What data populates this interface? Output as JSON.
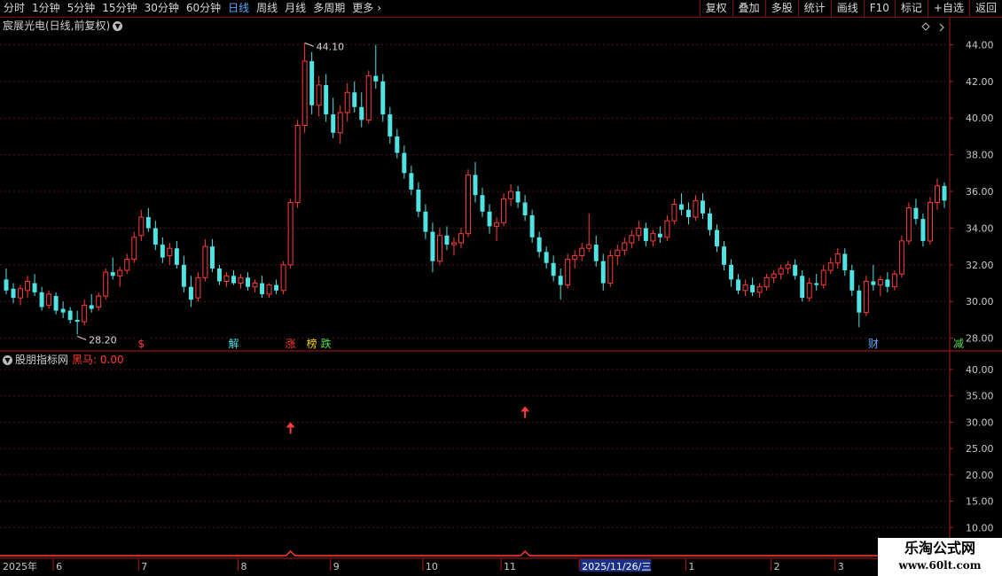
{
  "toolbar": {
    "periods": [
      "分时",
      "1分钟",
      "5分钟",
      "15分钟",
      "30分钟",
      "60分钟",
      "日线",
      "周线",
      "月线",
      "多周期",
      "更多"
    ],
    "active_period": "日线",
    "more_arrow": "chevron-right-icon",
    "buttons": [
      "复权",
      "叠加",
      "多股",
      "统计",
      "画线",
      "F10",
      "标记",
      "+自选",
      "返回"
    ]
  },
  "main": {
    "title": "宸展光电(日线,前复权)",
    "title_icon": "chevron-down-icon",
    "corner_icon": "diamond-icon"
  },
  "indicator": {
    "name": "股朋指标网",
    "series_label": "黑马: 0.00"
  },
  "watermark": {
    "line1": "乐淘公式网",
    "line2": "www.60lt.com"
  },
  "colors": {
    "up": "#ff3b3b",
    "down": "#4fe3e3",
    "grid": "#5a1414",
    "border": "#b01818",
    "axis_text": "#c8c8c8",
    "active": "#5aa8ff"
  },
  "chart_data": [
    {
      "type": "candlestick",
      "title": "宸展光电(日线,前复权)",
      "ylim": [
        27.5,
        44.6
      ],
      "yticks": [
        "44.00",
        "42.00",
        "40.00",
        "38.00",
        "36.00",
        "34.00",
        "32.00",
        "30.00",
        "28.00"
      ],
      "annotations": [
        {
          "text": "44.10",
          "value": 44.1,
          "index": 42
        },
        {
          "text": "28.20",
          "value": 28.2,
          "index": 10
        }
      ],
      "event_markers": [
        {
          "text": "$",
          "index": 19,
          "color": "#ff3b3b"
        },
        {
          "text": "解",
          "index": 32,
          "color": "#4fe3e3"
        },
        {
          "text": "涨",
          "index": 40,
          "color": "#ff3b3b"
        },
        {
          "text": "榜",
          "index": 43,
          "color": "#ffd400"
        },
        {
          "text": "跌",
          "index": 45,
          "color": "#55dd55"
        },
        {
          "text": "财",
          "index": 122,
          "color": "#5aa8ff"
        },
        {
          "text": "减",
          "index": 134,
          "color": "#55dd55"
        }
      ],
      "x_labels": [
        {
          "text": "2025年",
          "index": 0
        },
        {
          "text": "6",
          "index": 7
        },
        {
          "text": "7",
          "index": 19
        },
        {
          "text": "8",
          "index": 33
        },
        {
          "text": "9",
          "index": 46
        },
        {
          "text": "10",
          "index": 59
        },
        {
          "text": "11",
          "index": 70
        },
        {
          "text": "2025/11/26/三",
          "index": 81,
          "highlight": true
        },
        {
          "text": "1",
          "index": 96
        },
        {
          "text": "2",
          "index": 108
        },
        {
          "text": "3",
          "index": 117
        }
      ],
      "ohlc": [
        [
          31.2,
          31.8,
          30.4,
          30.6
        ],
        [
          30.7,
          31.0,
          29.9,
          30.2
        ],
        [
          30.2,
          30.9,
          29.8,
          30.7
        ],
        [
          30.6,
          31.4,
          30.2,
          31.1
        ],
        [
          31.0,
          31.5,
          30.3,
          30.5
        ],
        [
          30.5,
          30.8,
          29.5,
          29.7
        ],
        [
          29.8,
          30.6,
          29.6,
          30.4
        ],
        [
          30.3,
          30.5,
          29.3,
          29.5
        ],
        [
          29.6,
          30.0,
          29.1,
          29.4
        ],
        [
          29.5,
          29.7,
          28.8,
          29.0
        ],
        [
          29.0,
          29.5,
          28.2,
          28.9
        ],
        [
          28.9,
          30.1,
          28.7,
          29.8
        ],
        [
          29.8,
          30.4,
          29.4,
          29.6
        ],
        [
          29.7,
          30.5,
          29.5,
          30.3
        ],
        [
          30.3,
          31.8,
          30.1,
          31.6
        ],
        [
          31.6,
          32.4,
          31.2,
          31.4
        ],
        [
          31.4,
          31.9,
          30.8,
          31.7
        ],
        [
          31.7,
          32.6,
          31.5,
          32.3
        ],
        [
          32.3,
          33.8,
          32.1,
          33.5
        ],
        [
          33.6,
          35.0,
          33.3,
          34.6
        ],
        [
          34.6,
          35.1,
          33.8,
          34.0
        ],
        [
          34.0,
          34.4,
          32.8,
          33.1
        ],
        [
          33.1,
          33.5,
          32.1,
          32.4
        ],
        [
          32.5,
          33.2,
          32.0,
          32.9
        ],
        [
          32.9,
          33.3,
          31.8,
          32.0
        ],
        [
          32.0,
          32.5,
          30.5,
          30.8
        ],
        [
          30.8,
          31.4,
          29.7,
          30.1
        ],
        [
          30.2,
          31.6,
          30.0,
          31.3
        ],
        [
          31.3,
          33.4,
          31.1,
          33.0
        ],
        [
          33.0,
          33.4,
          31.6,
          31.8
        ],
        [
          31.8,
          32.0,
          30.9,
          31.1
        ],
        [
          31.1,
          31.6,
          30.8,
          31.4
        ],
        [
          31.4,
          31.7,
          30.9,
          31.0
        ],
        [
          31.0,
          31.5,
          30.7,
          31.3
        ],
        [
          31.3,
          31.6,
          30.6,
          30.8
        ],
        [
          30.8,
          31.2,
          30.5,
          31.0
        ],
        [
          31.0,
          31.4,
          30.2,
          30.4
        ],
        [
          30.4,
          31.0,
          30.2,
          30.9
        ],
        [
          30.9,
          31.2,
          30.4,
          30.6
        ],
        [
          30.6,
          32.2,
          30.4,
          32.0
        ],
        [
          32.0,
          35.6,
          31.8,
          35.4
        ],
        [
          35.4,
          39.9,
          35.1,
          39.6
        ],
        [
          39.6,
          44.1,
          39.2,
          43.1
        ],
        [
          43.1,
          43.6,
          40.2,
          40.7
        ],
        [
          40.7,
          42.3,
          40.1,
          41.8
        ],
        [
          41.8,
          42.4,
          39.8,
          40.2
        ],
        [
          40.2,
          41.1,
          38.9,
          39.2
        ],
        [
          39.2,
          40.7,
          38.6,
          40.3
        ],
        [
          40.3,
          41.9,
          39.8,
          41.4
        ],
        [
          41.4,
          42.0,
          40.3,
          40.6
        ],
        [
          40.6,
          41.4,
          39.5,
          39.9
        ],
        [
          39.9,
          42.6,
          39.7,
          42.3
        ],
        [
          42.3,
          44.0,
          41.6,
          42.0
        ],
        [
          42.0,
          42.4,
          39.8,
          40.2
        ],
        [
          40.2,
          40.6,
          38.6,
          39.0
        ],
        [
          39.0,
          39.4,
          37.8,
          38.1
        ],
        [
          38.1,
          38.5,
          36.7,
          37.0
        ],
        [
          37.0,
          37.4,
          35.8,
          36.1
        ],
        [
          36.1,
          36.5,
          34.6,
          34.9
        ],
        [
          34.9,
          35.3,
          33.4,
          33.8
        ],
        [
          33.8,
          34.3,
          31.6,
          32.2
        ],
        [
          32.2,
          34.0,
          32.0,
          33.6
        ],
        [
          33.6,
          34.1,
          32.8,
          33.1
        ],
        [
          33.1,
          33.5,
          32.5,
          33.2
        ],
        [
          33.2,
          34.0,
          32.9,
          33.7
        ],
        [
          33.7,
          37.2,
          33.5,
          36.9
        ],
        [
          36.9,
          37.6,
          35.4,
          35.8
        ],
        [
          35.8,
          36.2,
          34.6,
          34.9
        ],
        [
          34.9,
          35.3,
          33.7,
          34.1
        ],
        [
          34.1,
          34.6,
          33.3,
          34.3
        ],
        [
          34.3,
          35.9,
          34.1,
          35.6
        ],
        [
          35.6,
          36.4,
          35.2,
          36.0
        ],
        [
          36.0,
          36.3,
          35.1,
          35.4
        ],
        [
          35.4,
          35.8,
          34.4,
          34.7
        ],
        [
          34.7,
          35.0,
          33.2,
          33.5
        ],
        [
          33.5,
          33.8,
          32.4,
          32.7
        ],
        [
          32.7,
          33.0,
          31.8,
          32.1
        ],
        [
          32.1,
          32.5,
          31.1,
          31.4
        ],
        [
          31.4,
          31.8,
          30.1,
          30.9
        ],
        [
          30.9,
          32.6,
          30.7,
          32.3
        ],
        [
          32.3,
          32.8,
          31.8,
          32.5
        ],
        [
          32.5,
          33.2,
          32.2,
          32.9
        ],
        [
          32.9,
          34.8,
          32.7,
          33.1
        ],
        [
          33.1,
          33.6,
          31.9,
          32.2
        ],
        [
          32.2,
          32.6,
          30.6,
          31.0
        ],
        [
          31.0,
          32.8,
          30.8,
          32.5
        ],
        [
          32.5,
          33.1,
          32.0,
          32.8
        ],
        [
          32.8,
          33.5,
          32.5,
          33.2
        ],
        [
          33.2,
          33.9,
          32.9,
          33.6
        ],
        [
          33.6,
          34.4,
          33.3,
          34.0
        ],
        [
          34.0,
          34.3,
          33.0,
          33.3
        ],
        [
          33.3,
          33.9,
          33.0,
          33.7
        ],
        [
          33.7,
          34.1,
          33.2,
          33.5
        ],
        [
          33.5,
          34.7,
          33.3,
          34.4
        ],
        [
          34.4,
          35.6,
          34.2,
          35.3
        ],
        [
          35.3,
          35.9,
          34.7,
          35.0
        ],
        [
          35.0,
          35.4,
          34.2,
          34.6
        ],
        [
          34.6,
          35.8,
          34.4,
          35.5
        ],
        [
          35.5,
          35.9,
          34.5,
          34.8
        ],
        [
          34.8,
          35.1,
          33.6,
          33.9
        ],
        [
          33.9,
          34.2,
          32.7,
          33.0
        ],
        [
          33.0,
          33.3,
          31.7,
          32.0
        ],
        [
          32.0,
          32.3,
          30.8,
          31.2
        ],
        [
          31.2,
          31.5,
          30.4,
          30.6
        ],
        [
          30.6,
          31.2,
          30.3,
          30.9
        ],
        [
          30.9,
          31.3,
          30.3,
          30.5
        ],
        [
          30.5,
          31.0,
          30.2,
          30.8
        ],
        [
          30.8,
          31.5,
          30.6,
          31.3
        ],
        [
          31.3,
          31.7,
          31.0,
          31.5
        ],
        [
          31.5,
          32.0,
          31.2,
          31.8
        ],
        [
          31.8,
          32.2,
          31.5,
          32.0
        ],
        [
          32.0,
          32.3,
          31.2,
          31.4
        ],
        [
          31.4,
          31.7,
          30.0,
          30.2
        ],
        [
          30.2,
          31.3,
          30.0,
          31.0
        ],
        [
          31.0,
          31.5,
          30.6,
          30.9
        ],
        [
          30.9,
          32.0,
          30.7,
          31.7
        ],
        [
          31.7,
          32.4,
          31.5,
          32.1
        ],
        [
          32.1,
          32.9,
          31.8,
          32.6
        ],
        [
          32.6,
          32.9,
          31.4,
          31.7
        ],
        [
          31.7,
          32.0,
          30.3,
          30.6
        ],
        [
          30.6,
          30.9,
          28.6,
          29.4
        ],
        [
          29.4,
          31.4,
          29.2,
          31.1
        ],
        [
          31.1,
          32.0,
          30.6,
          30.9
        ],
        [
          30.9,
          31.4,
          30.3,
          31.2
        ],
        [
          31.2,
          31.6,
          30.5,
          30.8
        ],
        [
          30.8,
          31.7,
          30.6,
          31.5
        ],
        [
          31.5,
          33.6,
          31.3,
          33.3
        ],
        [
          33.3,
          35.4,
          33.1,
          35.1
        ],
        [
          35.1,
          35.6,
          34.2,
          34.5
        ],
        [
          34.5,
          34.8,
          33.0,
          33.3
        ],
        [
          33.3,
          35.7,
          33.1,
          35.4
        ],
        [
          35.4,
          36.7,
          35.0,
          36.3
        ],
        [
          36.3,
          36.5,
          35.1,
          35.5
        ]
      ]
    },
    {
      "type": "line",
      "series": [
        {
          "name": "黑马",
          "values": [
            0.0
          ]
        }
      ],
      "ylim": [
        5.0,
        43.2
      ],
      "yticks": [
        "40.00",
        "35.00",
        "30.00",
        "25.00",
        "20.00",
        "15.00",
        "10.00"
      ],
      "signals": [
        {
          "index": 40,
          "value": 29
        },
        {
          "index": 73,
          "value": 32
        }
      ]
    }
  ]
}
